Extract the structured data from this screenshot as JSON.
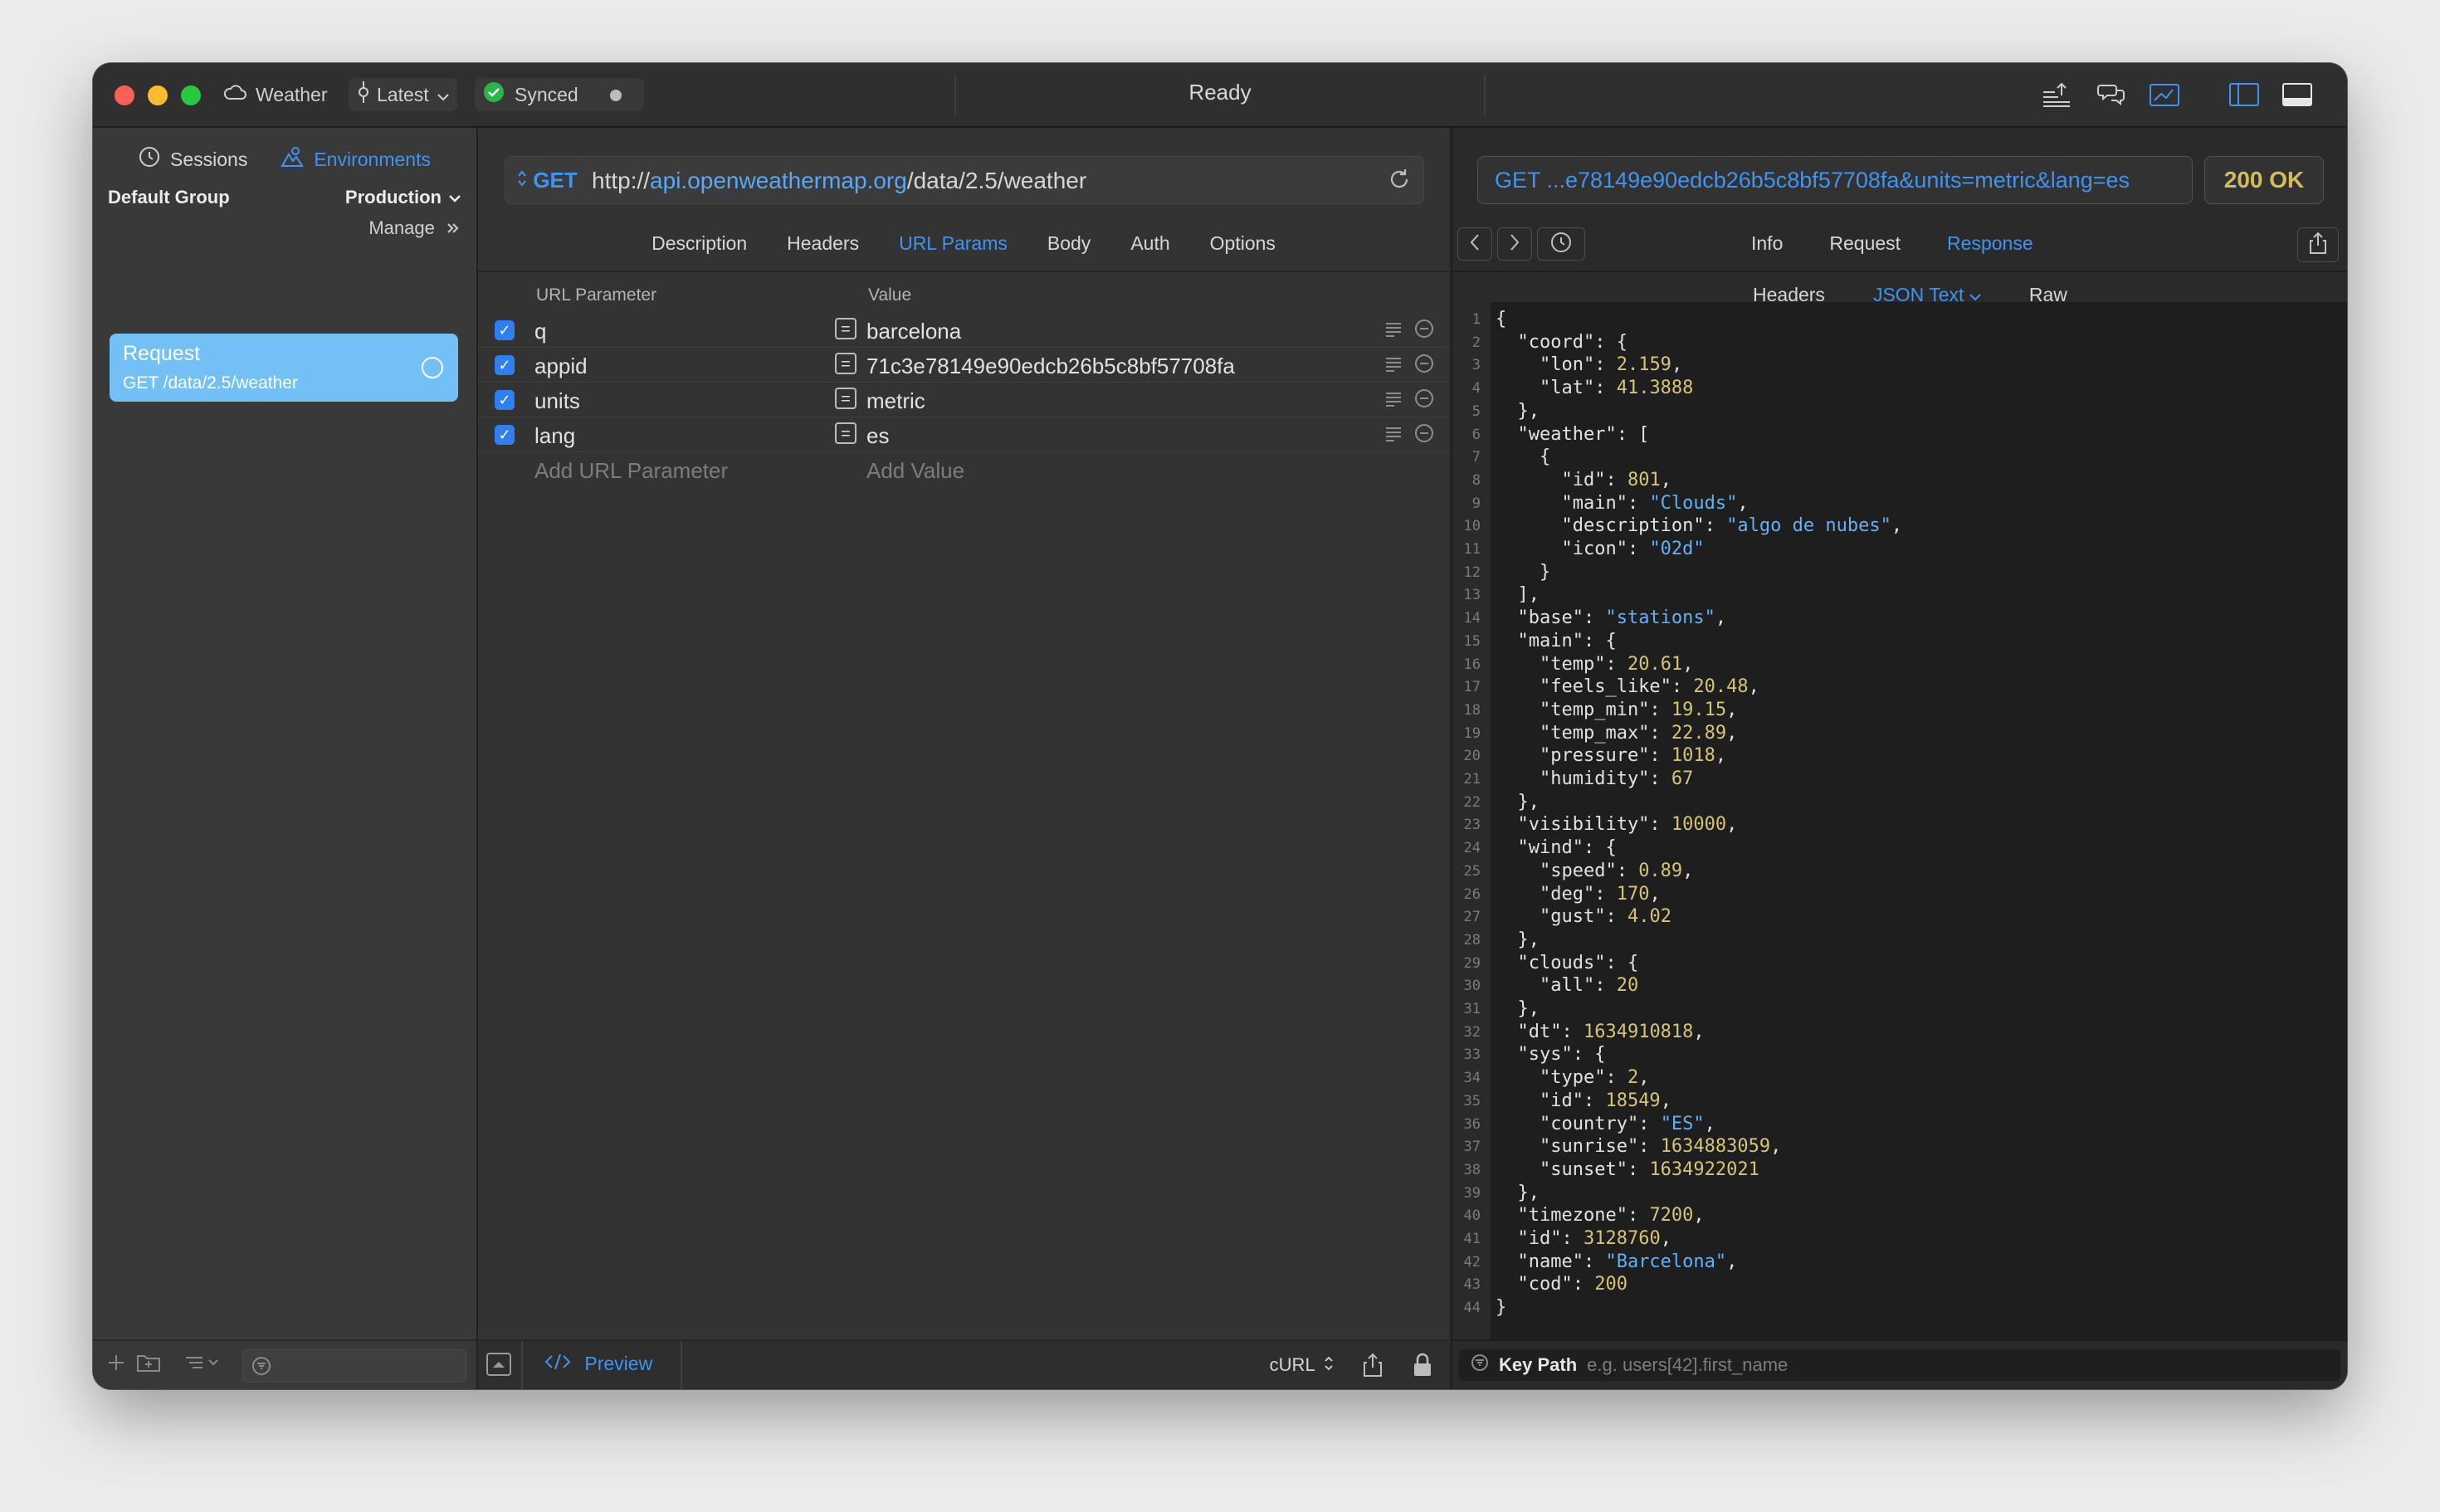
{
  "titlebar": {
    "project": "Weather",
    "branch": "Latest",
    "sync_status": "Synced",
    "title": "Ready"
  },
  "sidebar": {
    "tabs": [
      {
        "label": "Sessions",
        "active": false
      },
      {
        "label": "Environments",
        "active": true
      }
    ],
    "group_label": "Default Group",
    "environment": "Production",
    "manage_label": "Manage",
    "request": {
      "name": "Request",
      "subtitle": "GET /data/2.5/weather"
    }
  },
  "request": {
    "method": "GET",
    "url_scheme": "http://",
    "url_host": "api.openweathermap.org",
    "url_path": "/data/2.5/weather",
    "tabs": [
      {
        "label": "Description",
        "active": false
      },
      {
        "label": "Headers",
        "active": false
      },
      {
        "label": "URL Params",
        "active": true
      },
      {
        "label": "Body",
        "active": false
      },
      {
        "label": "Auth",
        "active": false
      },
      {
        "label": "Options",
        "active": false
      }
    ],
    "params_header": {
      "name": "URL Parameter",
      "value": "Value"
    },
    "params": [
      {
        "name": "q",
        "value": "barcelona",
        "enabled": true
      },
      {
        "name": "appid",
        "value": "71c3e78149e90edcb26b5c8bf57708fa",
        "enabled": true
      },
      {
        "name": "units",
        "value": "metric",
        "enabled": true
      },
      {
        "name": "lang",
        "value": "es",
        "enabled": true
      }
    ],
    "add_param_placeholder": "Add URL Parameter",
    "add_value_placeholder": "Add Value",
    "preview_label": "Preview",
    "export_format": "cURL"
  },
  "response": {
    "url": "GET ...e78149e90edcb26b5c8bf57708fa&units=metric&lang=es",
    "status": "200 OK",
    "tabs": [
      {
        "label": "Info",
        "active": false
      },
      {
        "label": "Request",
        "active": false
      },
      {
        "label": "Response",
        "active": true
      }
    ],
    "subtabs": [
      {
        "label": "Headers",
        "active": false
      },
      {
        "label": "JSON Text",
        "active": true
      },
      {
        "label": "Raw",
        "active": false
      }
    ],
    "keypath_label": "Key Path",
    "keypath_placeholder": "e.g. users[42].first_name",
    "json_lines": [
      "{",
      "  \"coord\": {",
      "    \"lon\": 2.159,",
      "    \"lat\": 41.3888",
      "  },",
      "  \"weather\": [",
      "    {",
      "      \"id\": 801,",
      "      \"main\": \"Clouds\",",
      "      \"description\": \"algo de nubes\",",
      "      \"icon\": \"02d\"",
      "    }",
      "  ],",
      "  \"base\": \"stations\",",
      "  \"main\": {",
      "    \"temp\": 20.61,",
      "    \"feels_like\": 20.48,",
      "    \"temp_min\": 19.15,",
      "    \"temp_max\": 22.89,",
      "    \"pressure\": 1018,",
      "    \"humidity\": 67",
      "  },",
      "  \"visibility\": 10000,",
      "  \"wind\": {",
      "    \"speed\": 0.89,",
      "    \"deg\": 170,",
      "    \"gust\": 4.02",
      "  },",
      "  \"clouds\": {",
      "    \"all\": 20",
      "  },",
      "  \"dt\": 1634910818,",
      "  \"sys\": {",
      "    \"type\": 2,",
      "    \"id\": 18549,",
      "    \"country\": \"ES\",",
      "    \"sunrise\": 1634883059,",
      "    \"sunset\": 1634922021",
      "  },",
      "  \"timezone\": 7200,",
      "  \"id\": 3128760,",
      "  \"name\": \"Barcelona\",",
      "  \"cod\": 200",
      "}"
    ]
  },
  "colors": {
    "accent": "#3e94f0",
    "selected_request": "#73c0f7",
    "status_ok": "#d2bd5a"
  }
}
